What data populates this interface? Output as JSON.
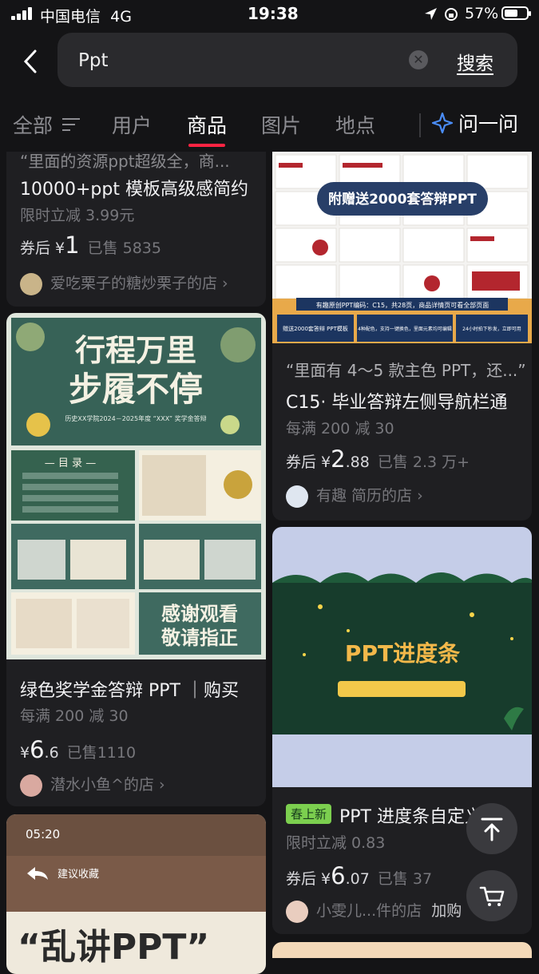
{
  "status": {
    "carrier": "中国电信",
    "network": "4G",
    "time": "19:38",
    "battery": "57%"
  },
  "search": {
    "value": "Ppt",
    "button": "搜索"
  },
  "tabs": [
    "全部",
    "用户",
    "商品",
    "图片",
    "地点"
  ],
  "ask": "问一问",
  "left": [
    {
      "quote": "“里面的资源ppt超级全，商...",
      "title": "10000+ppt 模板高级感简约",
      "desc": "限时立减 3.99元",
      "coupon": "券后 ¥",
      "price": "1",
      "sold": "已售 5835",
      "shop": "爱吃栗子的糖炒栗子的店"
    },
    {
      "title": "绿色奖学金答辩 PPT ｜购买",
      "desc": "每满 200 减 30",
      "coupon": "¥",
      "price_int": "6",
      "price_dec": ".6",
      "sold": "已售1110",
      "shop": "潜水小鱼^的店",
      "image": {
        "t1": "行程万里",
        "t2": "步履不停",
        "sub": "历史XX学院2024－2025年度 “XXX” 奖学金答辩",
        "toc": "— 目 录 —",
        "thanks1": "感谢观看",
        "thanks2": "敬请指正"
      }
    },
    {
      "image": {
        "time": "05:20",
        "label": "建议收藏",
        "big": "“乱讲PPT”"
      }
    }
  ],
  "right": [
    {
      "badge": "附赠送2000套答辩PPT",
      "banner": "有趣原创PPT编码：C15，共28页，商品详情页可看全部页面",
      "features": [
        "赠送2000套答辩 PPT模板",
        "4种配色，支持一键换色，里面元素均可编辑",
        "24小时拍下秒发，立即可用"
      ],
      "quote": "“里面有 4～5 款主色 PPT，还...”",
      "title": "C15· 毕业答辩左侧导航栏通",
      "desc": "每满 200 减 30",
      "coupon": "券后 ¥",
      "price_int": "2",
      "price_dec": ".88",
      "sold": "已售 2.3 万+",
      "shop": "有趣 简历的店"
    },
    {
      "image_title": "PPT进度条",
      "tag": "春上新",
      "title": "PPT 进度条自定义",
      "desc": "限时立减 0.83",
      "coupon": "券后 ¥",
      "price_int": "6",
      "price_dec": ".07",
      "sold": "已售 37",
      "shop": "小雯儿...件的店",
      "join": "加购"
    }
  ],
  "colors": {
    "bg": "#141416",
    "card": "#1f1f22",
    "accent": "#ff2442",
    "tag": "#7ccf4f"
  }
}
